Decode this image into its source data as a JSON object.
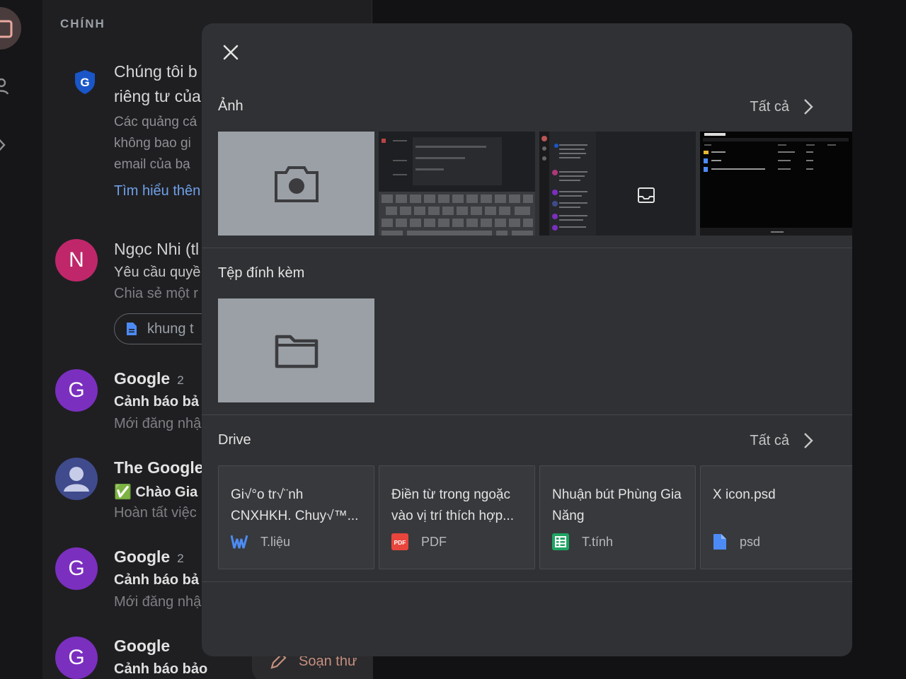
{
  "background": {
    "section_label": "CHÍNH",
    "promo": {
      "title": "Chúng tôi b… riêng tư của",
      "title_line1": "Chúng tôi b",
      "title_line2": "riêng tư của",
      "body_line1": "Các quảng cá",
      "body_line2": "không bao gi",
      "body_line3": "email của bạ",
      "link": "Tìm hiểu thên"
    },
    "emails": [
      {
        "avatar": "N",
        "color": "#c0276a",
        "sender": "Ngọc Nhi (tl",
        "count": "",
        "subject": "Yêu cầu quyề",
        "snippet": "Chia sẻ một r",
        "chip": "khung t"
      },
      {
        "avatar": "G",
        "color": "#7b2fbf",
        "sender": "Google",
        "count": "2",
        "subject": "Cảnh báo bả",
        "snippet": "Mới đăng nhậ"
      },
      {
        "avatar": "",
        "color": "#3f4b8c",
        "sender": "The Google",
        "count": "",
        "subject": "✅ Chào Gia",
        "snippet": "Hoàn tất việc"
      },
      {
        "avatar": "G",
        "color": "#7b2fbf",
        "sender": "Google",
        "count": "2",
        "subject": "Cảnh báo bả",
        "snippet": "Mới đăng nhậ"
      },
      {
        "avatar": "G",
        "color": "#7b2fbf",
        "sender": "Google",
        "count": "",
        "subject": "Cảnh báo bảo",
        "snippet": ""
      }
    ],
    "compose_label": "Soạn thư"
  },
  "modal": {
    "photos": {
      "title": "Ảnh",
      "see_all": "Tất cả"
    },
    "attachments": {
      "title": "Tệp đính kèm"
    },
    "drive": {
      "title": "Drive",
      "see_all": "Tất cả",
      "files": [
        {
          "name": "Gi√°o tr√¨nh CNXHKH. Chuy√™...",
          "type": "T.liệu",
          "icon": "word-icon"
        },
        {
          "name": "Điền từ trong ngoặc vào vị trí thích hợp...",
          "type": "PDF",
          "icon": "pdf-icon"
        },
        {
          "name": "Nhuận bút Phùng Gia Năng",
          "type": "T.tính",
          "icon": "sheets-icon"
        },
        {
          "name": "X icon.psd",
          "type": "psd",
          "icon": "file-icon"
        }
      ]
    }
  },
  "colors": {
    "accent_link": "#6fa0e8",
    "modal_bg": "#303134",
    "compose_text": "#c68f7e"
  }
}
